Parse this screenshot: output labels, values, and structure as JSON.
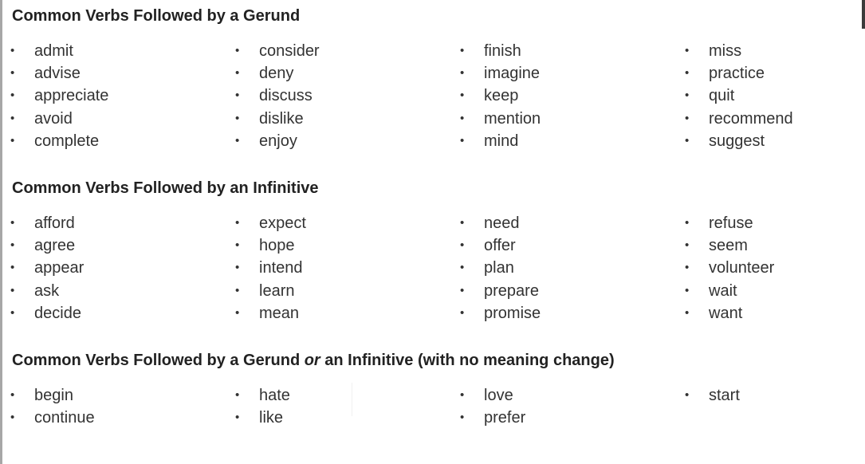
{
  "sections": [
    {
      "title": "Common Verbs Followed by a Gerund",
      "columns": [
        [
          "admit",
          "advise",
          "appreciate",
          "avoid",
          "complete"
        ],
        [
          "consider",
          "deny",
          "discuss",
          "dislike",
          "enjoy"
        ],
        [
          "finish",
          "imagine",
          "keep",
          "mention",
          "mind"
        ],
        [
          "miss",
          "practice",
          "quit",
          "recommend",
          "suggest"
        ]
      ]
    },
    {
      "title": "Common Verbs Followed by an Infinitive",
      "columns": [
        [
          "afford",
          "agree",
          "appear",
          "ask",
          "decide"
        ],
        [
          "expect",
          "hope",
          "intend",
          "learn",
          "mean"
        ],
        [
          "need",
          "offer",
          "plan",
          "prepare",
          "promise"
        ],
        [
          "refuse",
          "seem",
          "volunteer",
          "wait",
          "want"
        ]
      ]
    },
    {
      "title_before": "Common Verbs Followed by a Gerund ",
      "title_emphasis": "or",
      "title_after": " an Infinitive (with no meaning change)",
      "columns": [
        [
          "begin",
          "continue"
        ],
        [
          "hate",
          "like"
        ],
        [
          "love",
          "prefer"
        ],
        [
          "start"
        ]
      ]
    }
  ]
}
